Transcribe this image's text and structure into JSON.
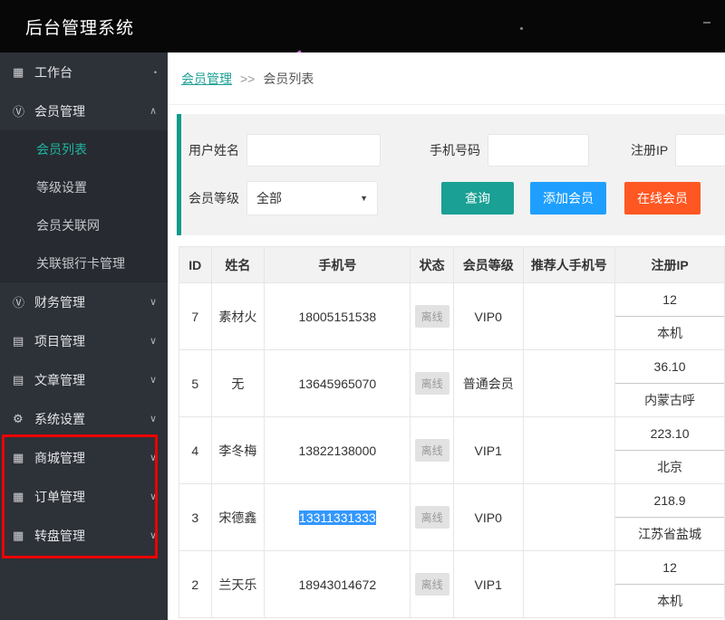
{
  "topbar": {
    "title": "后台管理系统"
  },
  "sidebar": {
    "items": [
      {
        "key": "workbench",
        "label": "工作台",
        "icon": "grid",
        "chevron": "dot"
      },
      {
        "key": "member-management",
        "label": "会员管理",
        "icon": "circle-v",
        "chevron": "up",
        "children": [
          {
            "key": "member-list",
            "label": "会员列表",
            "active": true
          },
          {
            "key": "level-settings",
            "label": "等级设置",
            "active": false
          },
          {
            "key": "member-network",
            "label": "会员关联网",
            "active": false
          },
          {
            "key": "bank-card-management",
            "label": "关联银行卡管理",
            "active": false
          }
        ]
      },
      {
        "key": "finance-management",
        "label": "财务管理",
        "icon": "circle-v",
        "chevron": "down"
      },
      {
        "key": "project-management",
        "label": "项目管理",
        "icon": "doc",
        "chevron": "down"
      },
      {
        "key": "article-management",
        "label": "文章管理",
        "icon": "doc",
        "chevron": "down"
      },
      {
        "key": "system-settings",
        "label": "系统设置",
        "icon": "gear",
        "chevron": "down"
      },
      {
        "key": "mall-management",
        "label": "商城管理",
        "icon": "grid",
        "chevron": "down"
      },
      {
        "key": "order-management",
        "label": "订单管理",
        "icon": "grid",
        "chevron": "down"
      },
      {
        "key": "wheel-management",
        "label": "转盘管理",
        "icon": "grid",
        "chevron": "down"
      }
    ]
  },
  "breadcrumb": {
    "parent": "会员管理",
    "separator": ">>",
    "current": "会员列表"
  },
  "filters": {
    "username_label": "用户姓名",
    "username_value": "",
    "phone_label": "手机号码",
    "phone_value": "",
    "ip_label": "注册IP",
    "ip_value": "",
    "level_label": "会员等级",
    "level_value": "全部",
    "search_button": "查询",
    "add_button": "添加会员",
    "online_button": "在线会员"
  },
  "table": {
    "headers": [
      "ID",
      "姓名",
      "手机号",
      "状态",
      "会员等级",
      "推荐人手机号",
      "注册IP"
    ],
    "rows": [
      {
        "id": "7",
        "name": "素材火",
        "phone": "18005151538",
        "phone_selected": false,
        "status": "离线",
        "level": "VIP0",
        "referrer": "",
        "ip_line1": "12",
        "ip_line2": "本机"
      },
      {
        "id": "5",
        "name": "无",
        "phone": "13645965070",
        "phone_selected": false,
        "status": "离线",
        "level": "普通会员",
        "referrer": "",
        "ip_line1": "36.10",
        "ip_line2": "内蒙古呼"
      },
      {
        "id": "4",
        "name": "李冬梅",
        "phone": "13822138000",
        "phone_selected": false,
        "status": "离线",
        "level": "VIP1",
        "referrer": "",
        "ip_line1": "223.10",
        "ip_line2": "北京"
      },
      {
        "id": "3",
        "name": "宋德鑫",
        "phone": "13311331333",
        "phone_selected": true,
        "status": "离线",
        "level": "VIP0",
        "referrer": "",
        "ip_line1": "218.9",
        "ip_line2": "江苏省盐城"
      },
      {
        "id": "2",
        "name": "兰天乐",
        "phone": "18943014672",
        "phone_selected": false,
        "status": "离线",
        "level": "VIP1",
        "referrer": "",
        "ip_line1": "12",
        "ip_line2": "本机"
      }
    ]
  },
  "colors": {
    "accent_teal": "#1aa094",
    "button_blue": "#1e9fff",
    "button_orange": "#ff5722",
    "annotation_red": "#ee0000",
    "selection_blue": "#3297fd",
    "sidebar_bg": "#2d3138",
    "topbar_bg": "#070707"
  }
}
